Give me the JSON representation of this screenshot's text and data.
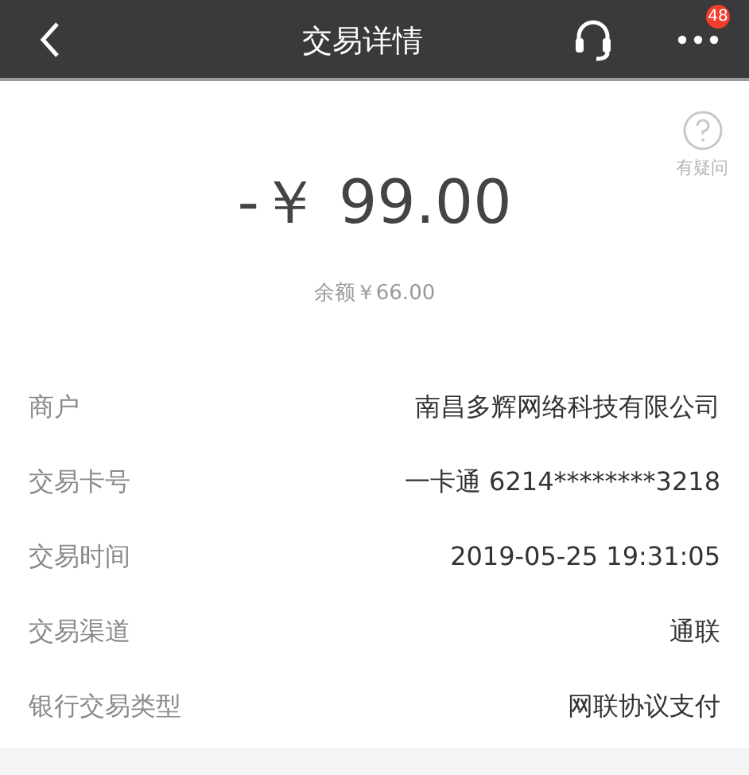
{
  "header": {
    "title": "交易详情",
    "badge": "48"
  },
  "help": {
    "label": "有疑问"
  },
  "amount": "-￥ 99.00",
  "balance": "余额￥66.00",
  "details": [
    {
      "label": "商户",
      "value": "南昌多辉网络科技有限公司"
    },
    {
      "label": "交易卡号",
      "value": "一卡通 6214********3218"
    },
    {
      "label": "交易时间",
      "value": "2019-05-25 19:31:05"
    },
    {
      "label": "交易渠道",
      "value": "通联"
    },
    {
      "label": "银行交易类型",
      "value": "网联协议支付"
    }
  ]
}
